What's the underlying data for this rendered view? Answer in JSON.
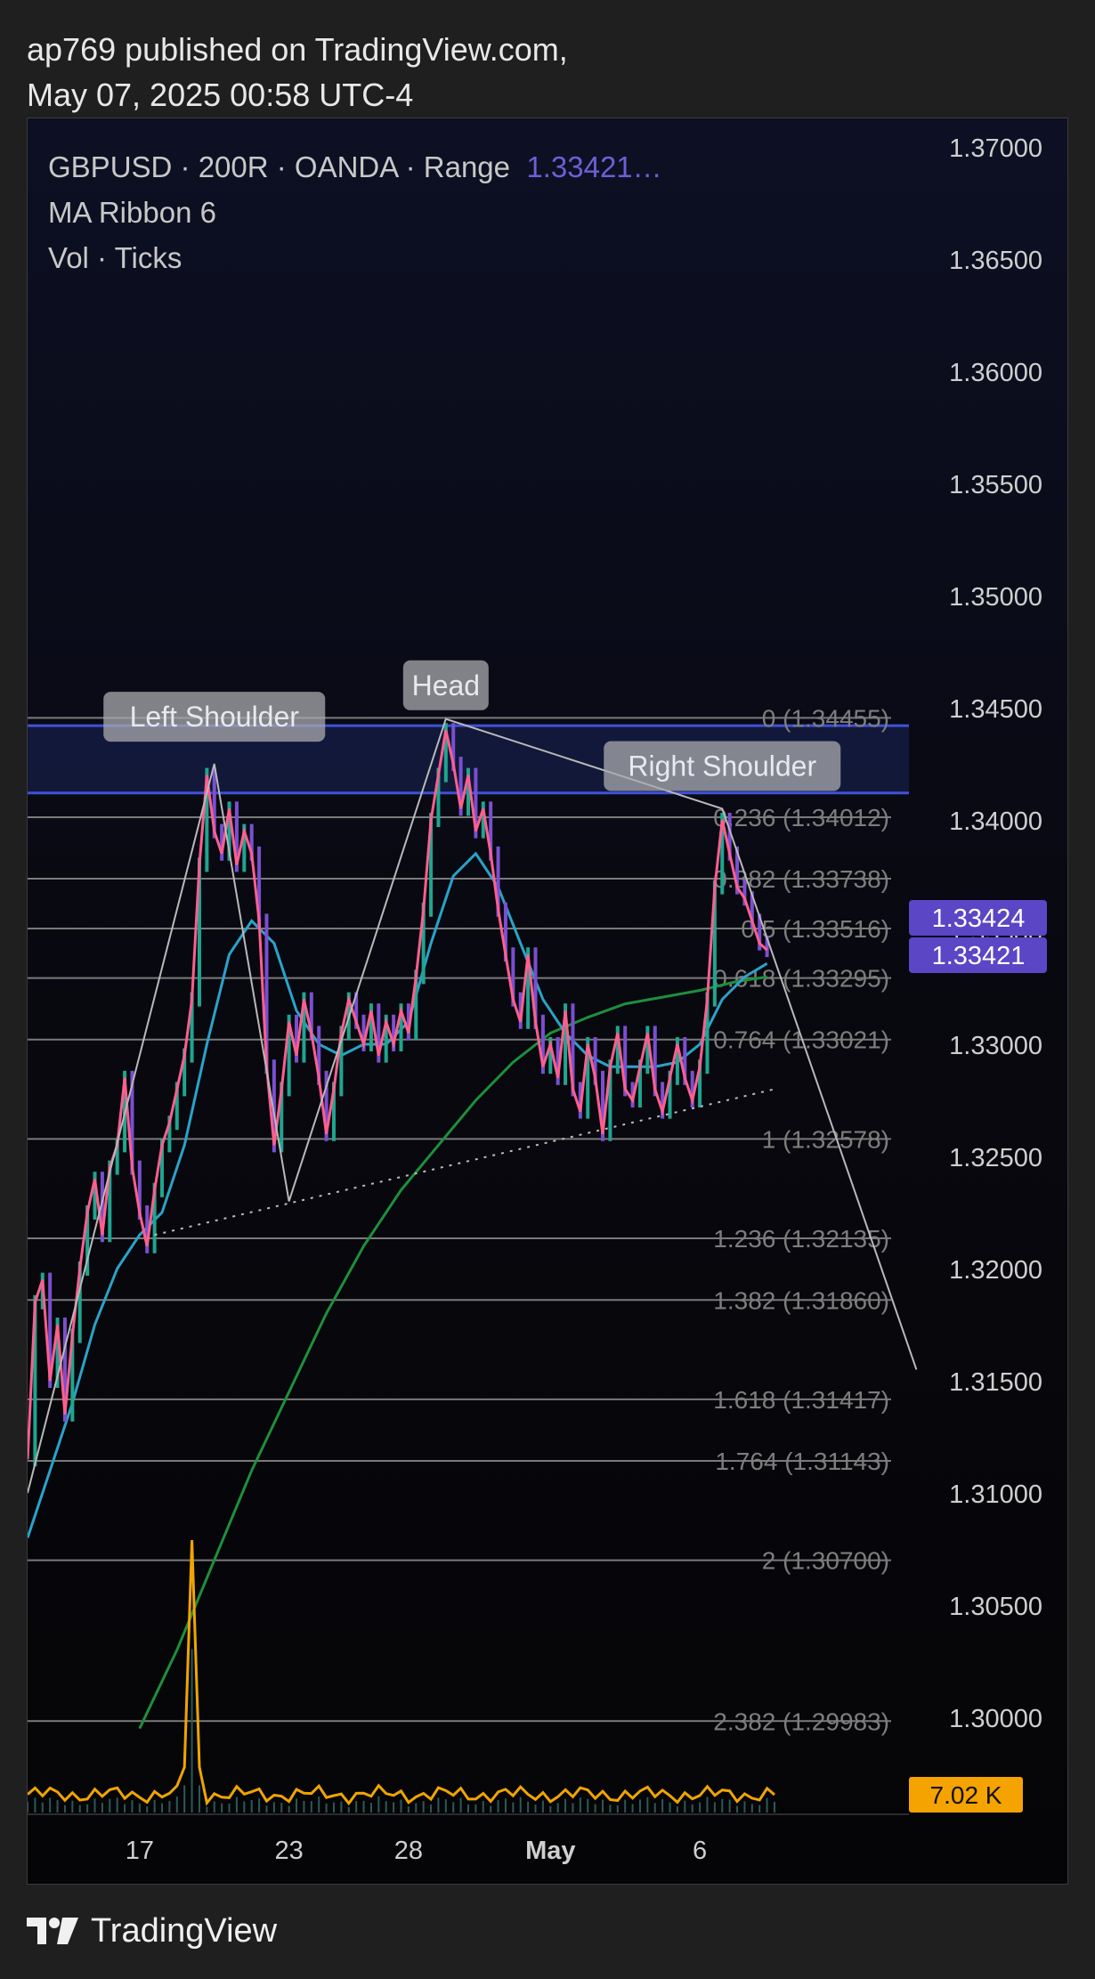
{
  "header": {
    "published": "ap769 published on TradingView.com,",
    "date": "May 07, 2025 00:58 UTC-4"
  },
  "legend": {
    "symbol": "GBPUSD · 200R · OANDA · Range",
    "last_value": "1.33421…",
    "ma": "MA Ribbon 6",
    "vol": "Vol · Ticks"
  },
  "footer": {
    "brand": "TradingView"
  },
  "colors": {
    "background": "#0b0b10",
    "price_line": "#ff5f8f",
    "ma_fast": "#2aa3c8",
    "ma_slow": "#1e8f3c",
    "volume": "#f0a500",
    "fib": "#7a7a7a",
    "zone": "#3f51d8",
    "badge": "#5b46c6",
    "vol_badge": "#f5a300"
  },
  "chart_data": {
    "type": "line",
    "symbol": "GBPUSD",
    "ylim": [
      1.2975,
      1.3715
    ],
    "yticks": [
      "1.37000",
      "1.36500",
      "1.36000",
      "1.35500",
      "1.35000",
      "1.34500",
      "1.34000",
      "1.33500",
      "1.33000",
      "1.32500",
      "1.32000",
      "1.31500",
      "1.31000",
      "1.30500",
      "1.30000"
    ],
    "xticks": [
      {
        "label": "17",
        "x": 15
      },
      {
        "label": "23",
        "x": 35
      },
      {
        "label": "28",
        "x": 51
      },
      {
        "label": "May",
        "x": 70
      },
      {
        "label": "6",
        "x": 90
      }
    ],
    "xlim": [
      0,
      118
    ],
    "price": [
      [
        0,
        1.3115
      ],
      [
        1,
        1.3185
      ],
      [
        2,
        1.3195
      ],
      [
        3,
        1.315
      ],
      [
        4,
        1.3175
      ],
      [
        5,
        1.3135
      ],
      [
        6,
        1.317
      ],
      [
        7,
        1.32
      ],
      [
        8,
        1.3225
      ],
      [
        9,
        1.324
      ],
      [
        10,
        1.3215
      ],
      [
        11,
        1.3245
      ],
      [
        12,
        1.3255
      ],
      [
        13,
        1.3285
      ],
      [
        14,
        1.3245
      ],
      [
        15,
        1.3225
      ],
      [
        16,
        1.321
      ],
      [
        17,
        1.3235
      ],
      [
        18,
        1.3255
      ],
      [
        19,
        1.3265
      ],
      [
        20,
        1.328
      ],
      [
        21,
        1.3295
      ],
      [
        22,
        1.332
      ],
      [
        23,
        1.338
      ],
      [
        24,
        1.342
      ],
      [
        25,
        1.3395
      ],
      [
        26,
        1.3385
      ],
      [
        27,
        1.3405
      ],
      [
        28,
        1.338
      ],
      [
        29,
        1.3395
      ],
      [
        30,
        1.3385
      ],
      [
        31,
        1.3355
      ],
      [
        32,
        1.329
      ],
      [
        33,
        1.3255
      ],
      [
        34,
        1.328
      ],
      [
        35,
        1.331
      ],
      [
        36,
        1.3295
      ],
      [
        37,
        1.332
      ],
      [
        38,
        1.3305
      ],
      [
        39,
        1.3285
      ],
      [
        40,
        1.326
      ],
      [
        41,
        1.328
      ],
      [
        42,
        1.3305
      ],
      [
        43,
        1.332
      ],
      [
        44,
        1.331
      ],
      [
        45,
        1.33
      ],
      [
        46,
        1.3315
      ],
      [
        47,
        1.3295
      ],
      [
        48,
        1.331
      ],
      [
        49,
        1.33
      ],
      [
        50,
        1.3315
      ],
      [
        51,
        1.3305
      ],
      [
        52,
        1.333
      ],
      [
        53,
        1.336
      ],
      [
        54,
        1.34
      ],
      [
        55,
        1.342
      ],
      [
        56,
        1.344
      ],
      [
        57,
        1.3425
      ],
      [
        58,
        1.3405
      ],
      [
        59,
        1.342
      ],
      [
        60,
        1.3395
      ],
      [
        61,
        1.3405
      ],
      [
        62,
        1.3385
      ],
      [
        63,
        1.336
      ],
      [
        64,
        1.334
      ],
      [
        65,
        1.332
      ],
      [
        66,
        1.331
      ],
      [
        67,
        1.334
      ],
      [
        68,
        1.331
      ],
      [
        69,
        1.329
      ],
      [
        70,
        1.33
      ],
      [
        71,
        1.3285
      ],
      [
        72,
        1.3315
      ],
      [
        73,
        1.328
      ],
      [
        74,
        1.327
      ],
      [
        75,
        1.33
      ],
      [
        76,
        1.3285
      ],
      [
        77,
        1.326
      ],
      [
        78,
        1.329
      ],
      [
        79,
        1.3305
      ],
      [
        80,
        1.328
      ],
      [
        81,
        1.3275
      ],
      [
        82,
        1.329
      ],
      [
        83,
        1.3305
      ],
      [
        84,
        1.328
      ],
      [
        85,
        1.327
      ],
      [
        86,
        1.3285
      ],
      [
        87,
        1.33
      ],
      [
        88,
        1.3285
      ],
      [
        89,
        1.3275
      ],
      [
        90,
        1.329
      ],
      [
        91,
        1.332
      ],
      [
        92,
        1.337
      ],
      [
        93,
        1.34
      ],
      [
        94,
        1.3385
      ],
      [
        95,
        1.337
      ],
      [
        96,
        1.3365
      ],
      [
        97,
        1.3355
      ],
      [
        98,
        1.3345
      ],
      [
        99,
        1.3342
      ]
    ],
    "ma_fast": [
      [
        0,
        1.308
      ],
      [
        3,
        1.311
      ],
      [
        6,
        1.314
      ],
      [
        9,
        1.3175
      ],
      [
        12,
        1.32
      ],
      [
        15,
        1.3215
      ],
      [
        18,
        1.3225
      ],
      [
        21,
        1.3255
      ],
      [
        24,
        1.33
      ],
      [
        27,
        1.334
      ],
      [
        30,
        1.3355
      ],
      [
        33,
        1.3345
      ],
      [
        36,
        1.3315
      ],
      [
        39,
        1.33
      ],
      [
        42,
        1.3295
      ],
      [
        45,
        1.33
      ],
      [
        48,
        1.33
      ],
      [
        51,
        1.331
      ],
      [
        54,
        1.3345
      ],
      [
        57,
        1.3375
      ],
      [
        60,
        1.3385
      ],
      [
        63,
        1.337
      ],
      [
        66,
        1.3345
      ],
      [
        69,
        1.332
      ],
      [
        72,
        1.3305
      ],
      [
        75,
        1.3295
      ],
      [
        78,
        1.329
      ],
      [
        81,
        1.329
      ],
      [
        84,
        1.329
      ],
      [
        87,
        1.3292
      ],
      [
        90,
        1.33
      ],
      [
        93,
        1.332
      ],
      [
        96,
        1.333
      ],
      [
        99,
        1.3336
      ]
    ],
    "ma_slow": [
      [
        15,
        1.2995
      ],
      [
        20,
        1.303
      ],
      [
        25,
        1.307
      ],
      [
        30,
        1.311
      ],
      [
        35,
        1.3145
      ],
      [
        40,
        1.318
      ],
      [
        45,
        1.321
      ],
      [
        50,
        1.3235
      ],
      [
        55,
        1.3255
      ],
      [
        60,
        1.3275
      ],
      [
        65,
        1.3292
      ],
      [
        70,
        1.3305
      ],
      [
        75,
        1.3312
      ],
      [
        80,
        1.3318
      ],
      [
        85,
        1.3321
      ],
      [
        90,
        1.3324
      ],
      [
        95,
        1.3328
      ],
      [
        99,
        1.333
      ]
    ],
    "fib_levels": [
      {
        "ratio": "0",
        "price": 1.34455,
        "label": "0 (1.34455)"
      },
      {
        "ratio": "0.236",
        "price": 1.34012,
        "label": "0.236 (1.34012)"
      },
      {
        "ratio": "0.382",
        "price": 1.33738,
        "label": "0.382 (1.33738)"
      },
      {
        "ratio": "0.5",
        "price": 1.33516,
        "label": "0.5 (1.33516)"
      },
      {
        "ratio": "0.618",
        "price": 1.33295,
        "label": "0.618 (1.33295)"
      },
      {
        "ratio": "0.764",
        "price": 1.33021,
        "label": "0.764 (1.33021)"
      },
      {
        "ratio": "1",
        "price": 1.32578,
        "label": "1 (1.32578)"
      },
      {
        "ratio": "1.236",
        "price": 1.32135,
        "label": "1.236 (1.32135)"
      },
      {
        "ratio": "1.382",
        "price": 1.3186,
        "label": "1.382 (1.31860)"
      },
      {
        "ratio": "1.618",
        "price": 1.31417,
        "label": "1.618 (1.31417)"
      },
      {
        "ratio": "1.764",
        "price": 1.31143,
        "label": "1.764 (1.31143)"
      },
      {
        "ratio": "2",
        "price": 1.307,
        "label": "2 (1.30700)"
      },
      {
        "ratio": "2.382",
        "price": 1.29983,
        "label": "2.382 (1.29983)"
      }
    ],
    "zone": [
      1.3412,
      1.3442
    ],
    "pattern": [
      [
        0,
        1.31
      ],
      [
        25,
        1.3425
      ],
      [
        35,
        1.323
      ],
      [
        56,
        1.3445
      ],
      [
        93,
        1.3405
      ],
      [
        119,
        1.3155
      ]
    ],
    "neckline": [
      [
        17,
        1.3215
      ],
      [
        100,
        1.328
      ]
    ],
    "annotations": [
      {
        "label": "Left Shoulder",
        "x": 25,
        "y": 1.3446
      },
      {
        "label": "Head",
        "x": 56,
        "y": 1.346
      },
      {
        "label": "Right Shoulder",
        "x": 93,
        "y": 1.3424
      }
    ],
    "price_badges": [
      "1.33424",
      "1.33421"
    ],
    "volume": {
      "spike": [
        [
          0,
          1.3
        ],
        [
          20,
          1.3
        ],
        [
          21,
          2
        ],
        [
          22,
          18
        ],
        [
          23,
          3
        ],
        [
          24,
          1.3
        ],
        [
          100,
          1.3
        ]
      ],
      "badge": "7.02 K"
    }
  }
}
